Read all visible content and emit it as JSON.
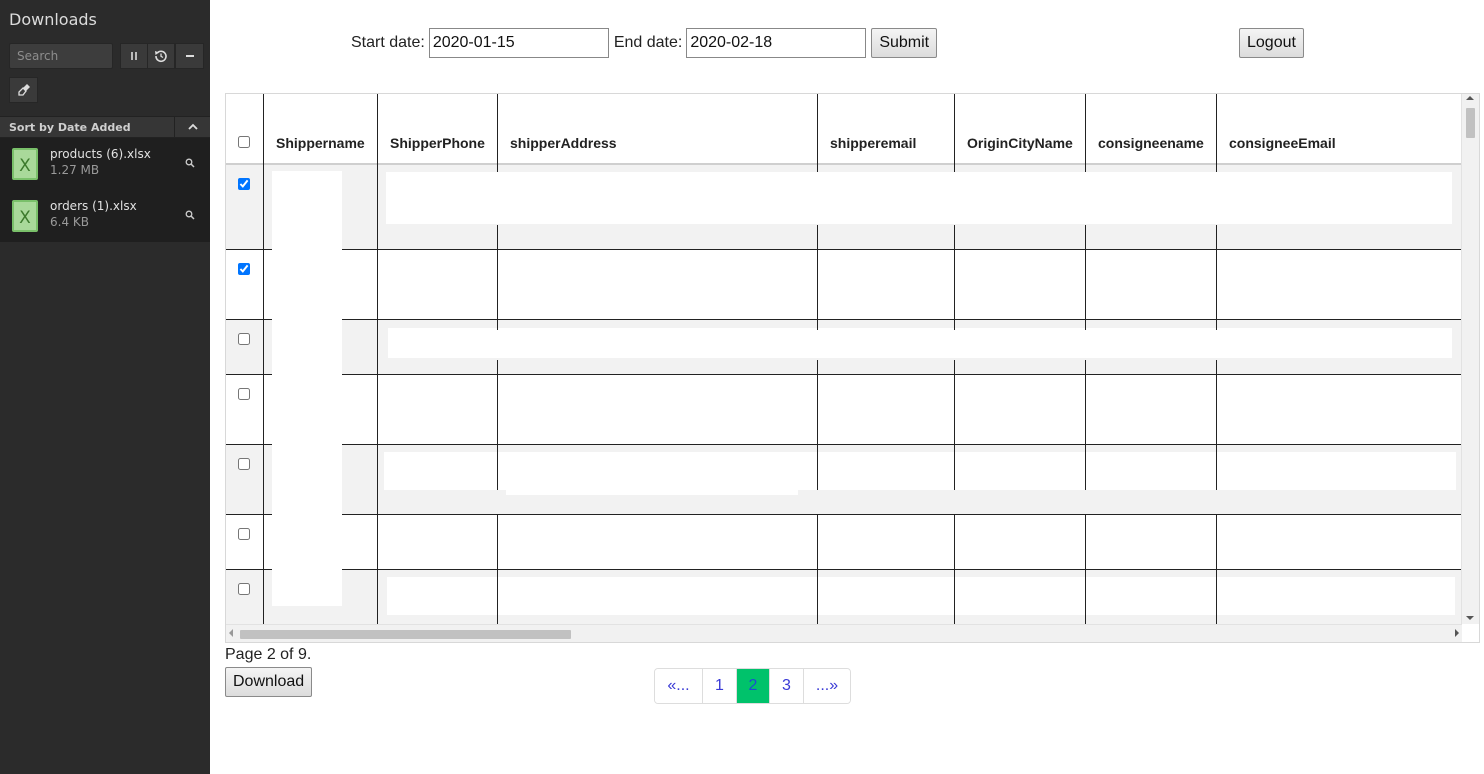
{
  "sidebar": {
    "title": "Downloads",
    "search_placeholder": "Search",
    "sort_label": "Sort by Date Added",
    "items": [
      {
        "name": "products (6).xlsx",
        "size": "1.27 MB"
      },
      {
        "name": "orders (1).xlsx",
        "size": "6.4 KB"
      }
    ],
    "icons": [
      "pause-icon",
      "history-icon",
      "minus-icon",
      "broom-icon",
      "chevron-up-icon",
      "excel-file-icon",
      "magnify-icon"
    ]
  },
  "filters": {
    "start_label": "Start date:",
    "start_value": "2020-01-15",
    "end_label": "End date:",
    "end_value": "2020-02-18",
    "submit_label": "Submit"
  },
  "logout_label": "Logout",
  "table": {
    "columns": [
      "Shippername",
      "ShipperPhone",
      "shipperAddress",
      "shipperemail",
      "OriginCityName",
      "consigneename",
      "consigneeEmail"
    ],
    "rows_checked": [
      true,
      true,
      false,
      false,
      false,
      false,
      false
    ]
  },
  "page_info": "Page 2 of 9.",
  "download_label": "Download",
  "pagination": {
    "prev": "«...",
    "pages": [
      "1",
      "2",
      "3"
    ],
    "current": "2",
    "next": "...»",
    "active_color": "#00c26b"
  }
}
